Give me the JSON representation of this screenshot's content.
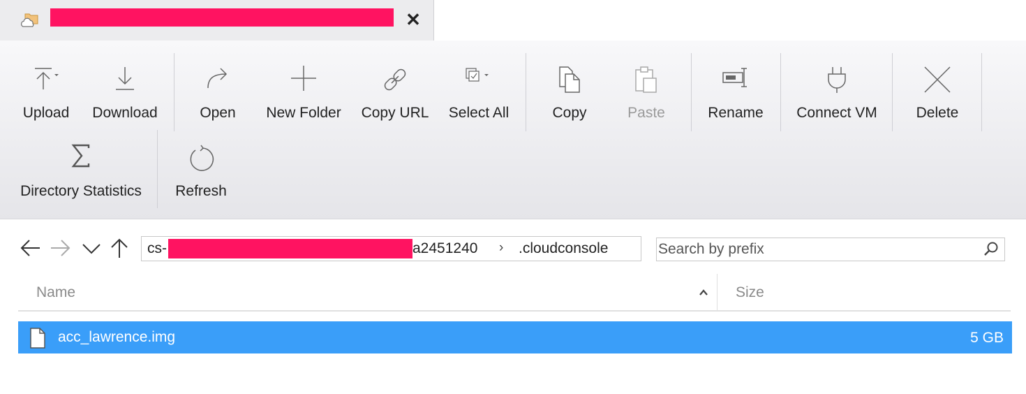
{
  "tab": {
    "title": "",
    "close_glyph": "✕",
    "icon": "cloud-folder-icon",
    "redacted_color": "#ff1361"
  },
  "ribbon": {
    "row1": [
      {
        "name": "upload",
        "label": "Upload",
        "icon": "upload-icon",
        "enabled": true
      },
      {
        "name": "download",
        "label": "Download",
        "icon": "download-icon",
        "enabled": true
      },
      {
        "name": "open",
        "label": "Open",
        "icon": "open-icon",
        "enabled": true
      },
      {
        "name": "new-folder",
        "label": "New Folder",
        "icon": "plus-icon",
        "enabled": true
      },
      {
        "name": "copy-url",
        "label": "Copy URL",
        "icon": "link-icon",
        "enabled": true
      },
      {
        "name": "select-all",
        "label": "Select All",
        "icon": "select-all-icon",
        "enabled": true
      },
      {
        "name": "copy",
        "label": "Copy",
        "icon": "copy-icon",
        "enabled": true
      },
      {
        "name": "paste",
        "label": "Paste",
        "icon": "paste-icon",
        "enabled": false
      },
      {
        "name": "rename",
        "label": "Rename",
        "icon": "rename-icon",
        "enabled": true
      },
      {
        "name": "connect-vm",
        "label": "Connect VM",
        "icon": "plug-icon",
        "enabled": true
      },
      {
        "name": "delete",
        "label": "Delete",
        "icon": "delete-icon",
        "enabled": true
      }
    ],
    "row2": [
      {
        "name": "directory-statistics",
        "label": "Directory Statistics",
        "icon": "sigma-icon",
        "enabled": true
      },
      {
        "name": "refresh",
        "label": "Refresh",
        "icon": "refresh-icon",
        "enabled": true
      }
    ]
  },
  "navigation": {
    "path_prefix": "cs-",
    "path_suffix": "a2451240",
    "path_separator": "›",
    "current_folder": ".cloudconsole",
    "search_placeholder": "Search by prefix",
    "search_value": ""
  },
  "table": {
    "columns": [
      {
        "label": "Name",
        "sorted": "ascending"
      },
      {
        "label": "Size"
      }
    ],
    "rows": [
      {
        "name": "acc_lawrence.img",
        "size": "5 GB",
        "selected": true
      }
    ]
  },
  "colors": {
    "selection": "#3a9ef9",
    "redaction": "#ff1361"
  }
}
